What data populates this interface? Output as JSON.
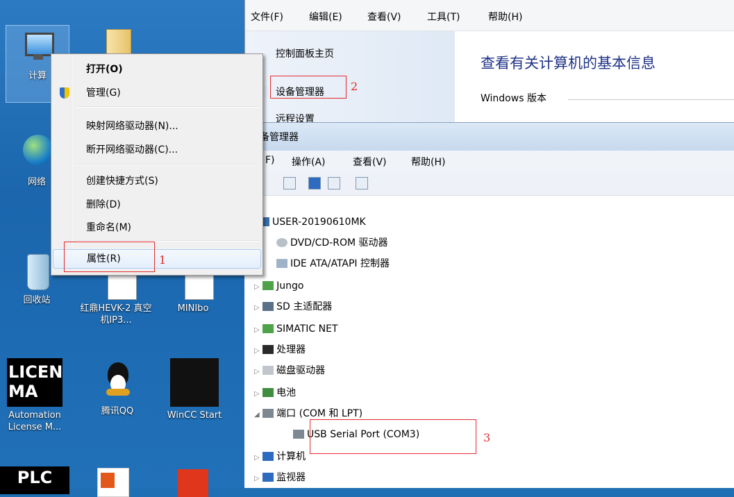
{
  "desktop": {
    "icons": [
      {
        "label": "计算",
        "name": "computer"
      },
      {
        "label": "网络",
        "name": "network"
      },
      {
        "label": "回收站",
        "name": "recycle-bin"
      },
      {
        "label": "红鼎HEVK-2 真空机IP3...",
        "name": "file-hevk"
      },
      {
        "label": "MINIbo",
        "name": "file-minibo"
      },
      {
        "label": "Automation License M...",
        "name": "automation-license"
      },
      {
        "label": "腾讯QQ",
        "name": "qq"
      },
      {
        "label": "WinCC Start",
        "name": "wincc"
      },
      {
        "label": "PLC",
        "name": "plc"
      },
      {
        "label": "LICEN MA",
        "name": "license-logo-text"
      }
    ]
  },
  "context_menu": {
    "items": [
      {
        "label": "打开(O)",
        "bold": true
      },
      {
        "label": "管理(G)"
      },
      {
        "label": "映射网络驱动器(N)..."
      },
      {
        "label": "断开网络驱动器(C)..."
      },
      {
        "label": "创建快捷方式(S)"
      },
      {
        "label": "删除(D)"
      },
      {
        "label": "重命名(M)"
      },
      {
        "label": "属性(R)"
      }
    ],
    "annotation": "1"
  },
  "control_panel": {
    "menu": [
      "文件(F)",
      "编辑(E)",
      "查看(V)",
      "工具(T)",
      "帮助(H)"
    ],
    "sidebar": [
      "控制面板主页",
      "设备管理器",
      "远程设置"
    ],
    "annotation": "2",
    "heading": "查看有关计算机的基本信息",
    "section": "Windows 版本"
  },
  "device_manager": {
    "title": "备管理器",
    "menu": [
      "F)",
      "操作(A)",
      "查看(V)",
      "帮助(H)"
    ],
    "root": "USER-20190610MK",
    "nodes": [
      "DVD/CD-ROM 驱动器",
      "IDE ATA/ATAPI 控制器",
      "Jungo",
      "SD 主适配器",
      "SIMATIC NET",
      "处理器",
      "磁盘驱动器",
      "电池",
      "端口 (COM 和 LPT)",
      "USB Serial Port (COM3)",
      "计算机",
      "监视器"
    ],
    "annotation": "3"
  },
  "colors": {
    "annotation_red": "#e3282a",
    "desktop_blue": "#1f6fb5"
  }
}
